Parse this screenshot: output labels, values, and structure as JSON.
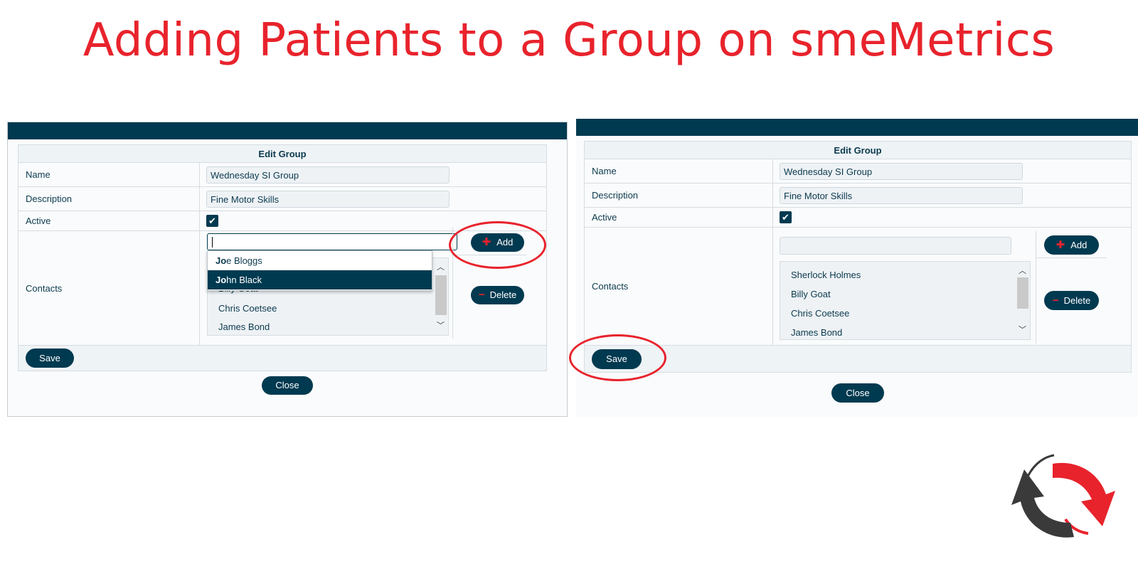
{
  "title": "Adding Patients to a Group on smeMetrics",
  "colors": {
    "accent_red": "#e8232c",
    "navy": "#003a50"
  },
  "left_dialog": {
    "heading": "Edit Group",
    "name_label": "Name",
    "name_value": "Wednesday SI Group",
    "description_label": "Description",
    "description_value": "Fine Motor Skills",
    "active_label": "Active",
    "active_checked": true,
    "contacts_label": "Contacts",
    "search_value": "",
    "autocomplete": [
      {
        "match": "Jo",
        "rest": "e Bloggs"
      },
      {
        "match": "Jo",
        "rest": "hn Black",
        "selected": true
      }
    ],
    "contacts": [
      "Billy Goat",
      "Chris Coetsee",
      "James Bond"
    ],
    "add_label": "Add",
    "delete_label": "Delete",
    "save_label": "Save",
    "close_label": "Close"
  },
  "right_dialog": {
    "heading": "Edit Group",
    "name_label": "Name",
    "name_value": "Wednesday SI Group",
    "description_label": "Description",
    "description_value": "Fine Motor Skills",
    "active_label": "Active",
    "active_checked": true,
    "contacts_label": "Contacts",
    "search_value": "",
    "contacts": [
      "Sherlock Holmes",
      "Billy Goat",
      "Chris Coetsee",
      "James Bond"
    ],
    "add_label": "Add",
    "delete_label": "Delete",
    "save_label": "Save",
    "close_label": "Close"
  },
  "icons": {
    "check": "check-icon",
    "plus": "plus-icon",
    "minus": "minus-icon",
    "logo": "sync-arrows-logo"
  }
}
